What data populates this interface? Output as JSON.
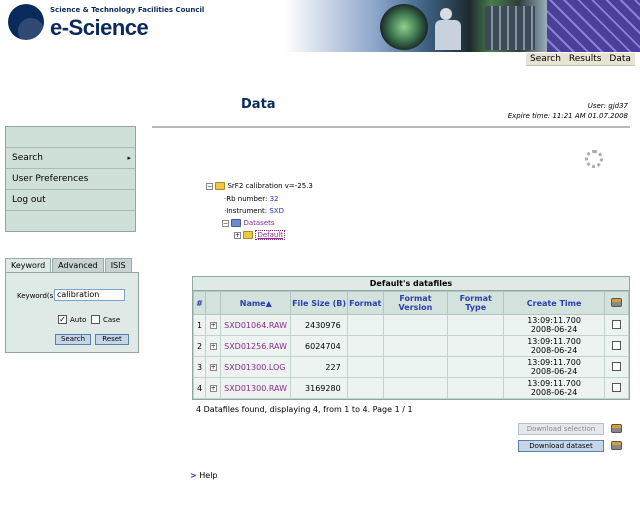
{
  "header": {
    "org": "Science & Technology Facilities Council",
    "brand": "e-Science",
    "nav": [
      "Search",
      "Results",
      "Data"
    ]
  },
  "page": {
    "title": "Data",
    "user_line": "User: gjd37",
    "expire_line": "Expire time: 11:21 AM 01.07.2008"
  },
  "sidebar": {
    "items": [
      {
        "label": "Search",
        "arrow": "▸"
      },
      {
        "label": "User Preferences"
      },
      {
        "label": "Log out"
      }
    ]
  },
  "search_panel": {
    "tabs": [
      "Keyword",
      "Advanced",
      "ISIS"
    ],
    "keyword_label": "Keyword(s):",
    "keyword_value": "calibration",
    "auto_label": "Auto",
    "auto_checked": "✓",
    "case_label": "Case",
    "search_button": "Search",
    "reset_button": "Reset"
  },
  "tree": {
    "root_label": "SrF2 calibration v=-25.3",
    "rb_label": "Rb number:",
    "rb_value": "32",
    "instrument_label": "Instrument:",
    "instrument_value": "SXD",
    "datasets_label": "Datasets",
    "default_label": "Default"
  },
  "table": {
    "caption": "Default's datafiles",
    "headers": {
      "num": "#",
      "name": "Name▲",
      "size": "File Size (B)",
      "format": "Format",
      "format_version": "Format Version",
      "format_type": "Format Type",
      "create_time": "Create Time"
    },
    "rows": [
      {
        "num": "1",
        "name": "SXD01064.RAW",
        "size": "2430976",
        "time": "13:09:11.700",
        "date": "2008-06-24"
      },
      {
        "num": "2",
        "name": "SXD01256.RAW",
        "size": "6024704",
        "time": "13:09:11.700",
        "date": "2008-06-24"
      },
      {
        "num": "3",
        "name": "SXD01300.LOG",
        "size": "227",
        "time": "13:09:11.700",
        "date": "2008-06-24"
      },
      {
        "num": "4",
        "name": "SXD01300.RAW",
        "size": "3169280",
        "time": "13:09:11.700",
        "date": "2008-06-24"
      }
    ],
    "footnote": "4 Datafiles found, displaying 4, from 1 to 4. Page 1 / 1"
  },
  "actions": {
    "download_selection": "Download selection",
    "download_dataset": "Download dataset"
  },
  "help": {
    "arrow": ">",
    "label": "Help"
  },
  "colors": {
    "brand": "#0b2a5c",
    "panel": "#cfe0d9",
    "link": "#2b2bc8",
    "file_link": "#8a2b8a"
  }
}
